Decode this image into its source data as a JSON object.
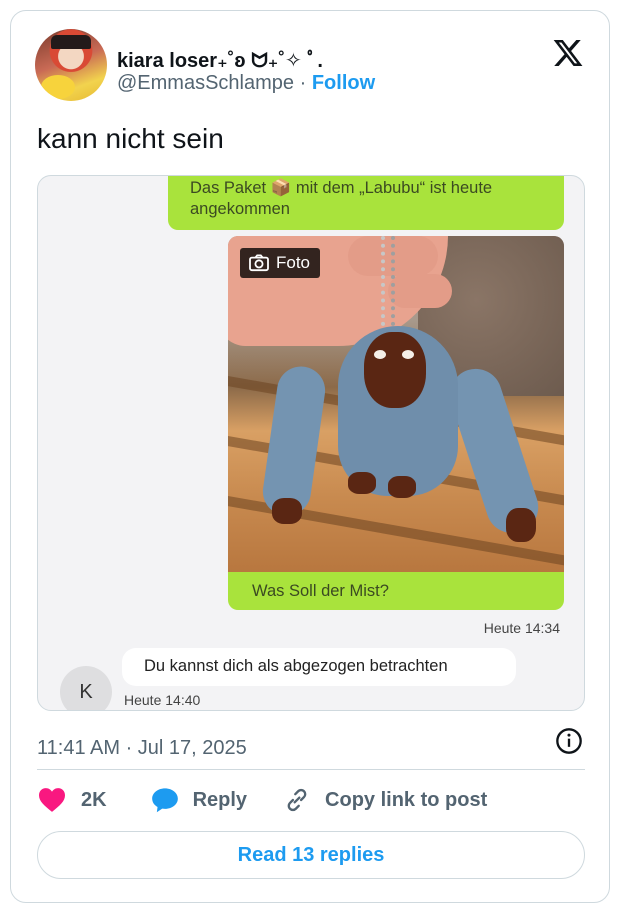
{
  "author": {
    "display_name": "kiara loser₊˚ʚ ᗢ₊˚✧ ﾟ.",
    "handle": "@EmmasSchlampe",
    "separator": "·",
    "follow_label": "Follow"
  },
  "tweet": {
    "text": "kann nicht sein",
    "timestamp": "11:41 AM · Jul 17, 2025"
  },
  "media": {
    "chat": {
      "message_1": "Das Paket 📦 mit dem „Labubu“ ist heute angekommen",
      "photo_tag": "Foto",
      "message_2": "Was Soll der Mist?",
      "time_sent": "Heute 14:34",
      "reply": "Du kannst dich als abgezogen betrachten",
      "reply_avatar_letter": "K",
      "time_reply": "Heute 14:40"
    }
  },
  "actions": {
    "like_count": "2K",
    "reply_label": "Reply",
    "copy_link_label": "Copy link to post"
  },
  "read_replies_label": "Read 13 replies",
  "colors": {
    "accent": "#1d9bf0",
    "like": "#f91880",
    "chat_green": "#a9e33c"
  }
}
